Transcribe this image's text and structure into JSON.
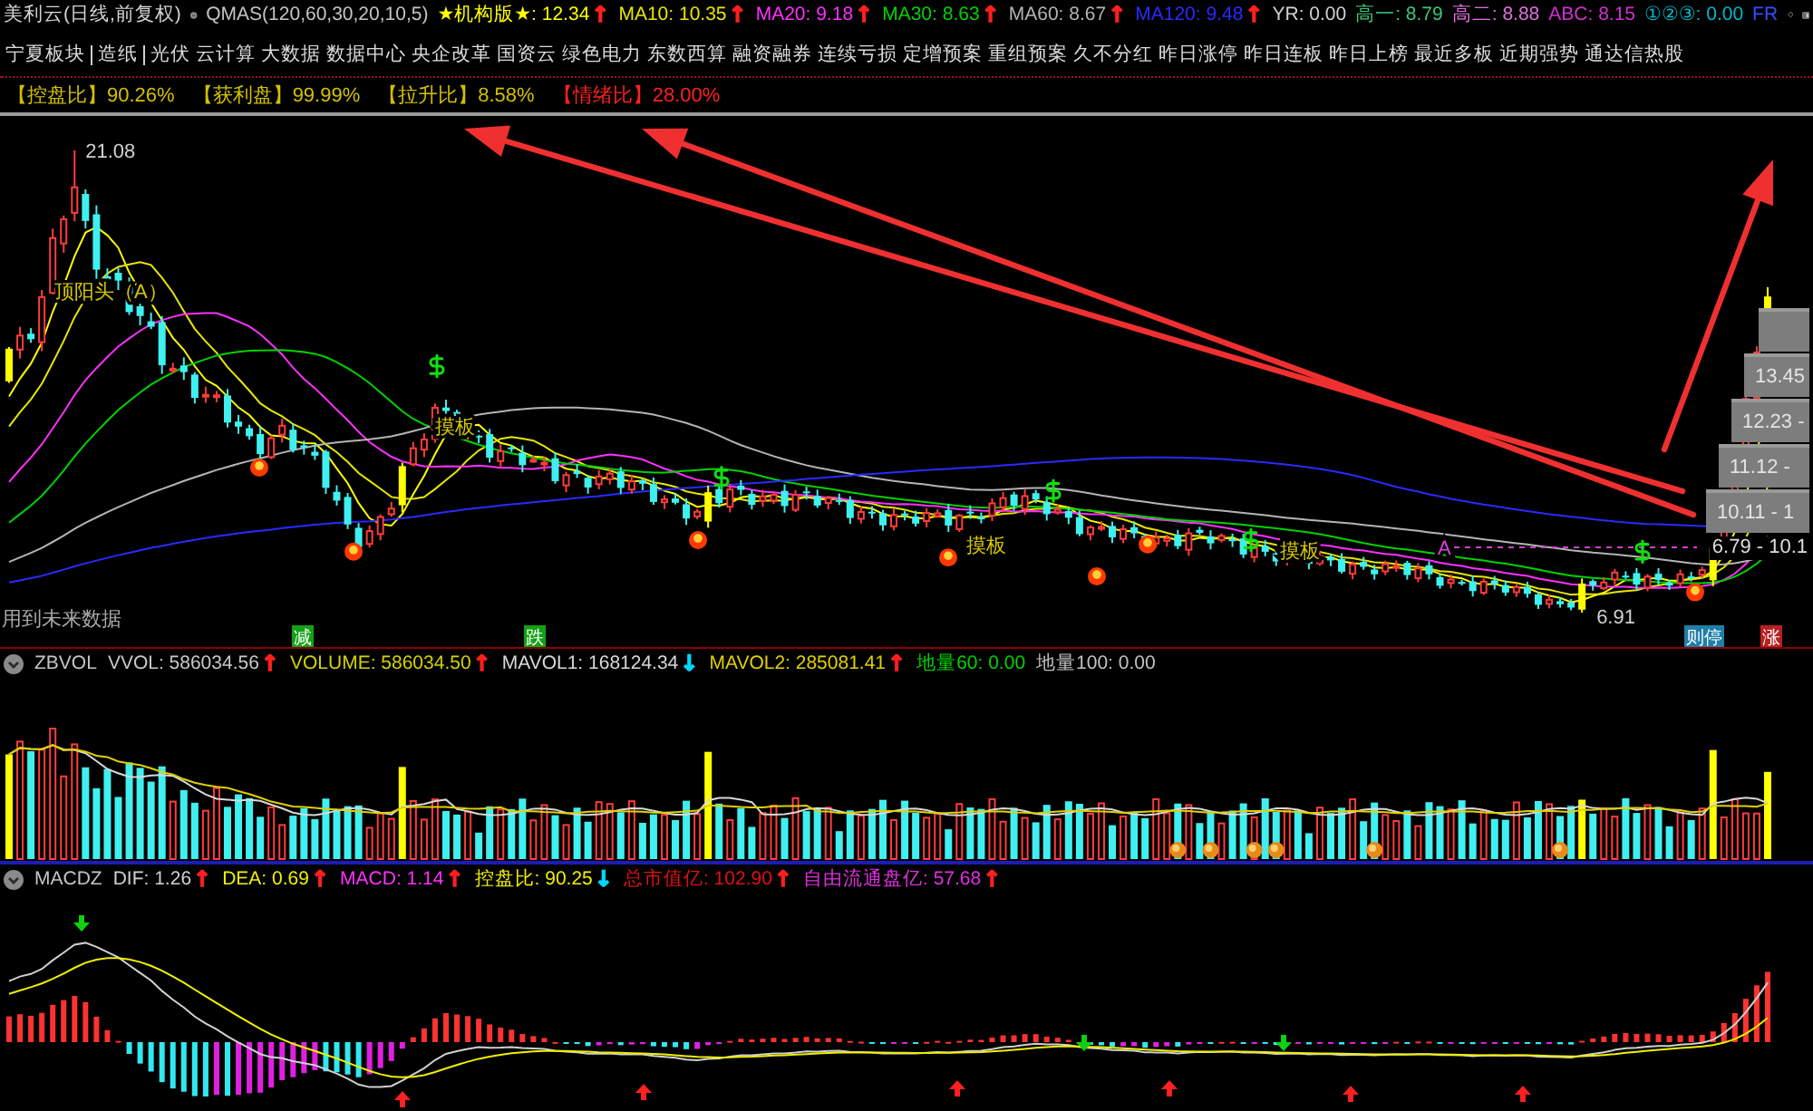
{
  "main_panel": {
    "title": "美利云(日线,前复权)",
    "indicator": "QMAS(120,60,30,20,10,5)",
    "readings": [
      {
        "text": "★机构版★: 12.34",
        "color": "#ffff00",
        "arrow": {
          "text": "↑",
          "color": "#ff2020"
        }
      },
      {
        "text": "MA10: 10.35",
        "color": "#e6e600",
        "arrow": {
          "text": "↑",
          "color": "#ff2020"
        }
      },
      {
        "text": "MA20: 9.18",
        "color": "#ff30ff",
        "arrow": {
          "text": "↑",
          "color": "#ff2020"
        }
      },
      {
        "text": "MA30: 8.63",
        "color": "#00d200",
        "arrow": {
          "text": "↑",
          "color": "#ff2020"
        }
      },
      {
        "text": "MA60: 8.67",
        "color": "#b4b4b4",
        "arrow": {
          "text": "↑",
          "color": "#ff2020"
        }
      },
      {
        "text": "MA120: 9.48",
        "color": "#2a2aff",
        "arrow": {
          "text": "↑",
          "color": "#ff2020"
        }
      },
      {
        "text": "YR: 0.00",
        "color": "#d0d0d0"
      },
      {
        "text": "高一: 8.79",
        "color": "#3cc878"
      },
      {
        "text": "高二: 8.88",
        "color": "#e070e0"
      },
      {
        "text": "ABC: 8.15",
        "color": "#d030d0"
      },
      {
        "text": "①②③: 0.00",
        "color": "#00b8c8"
      },
      {
        "text": "FR",
        "color": "#3050ff"
      }
    ],
    "region": "宁夏板块",
    "industry": "造纸",
    "concepts": [
      "光伏",
      "云计算",
      "大数据",
      "数据中心",
      "央企改革",
      "国资云",
      "绿色电力",
      "东数西算",
      "融资融券",
      "连续亏损",
      "定增预案",
      "重组预案",
      "久不分红",
      "昨日涨停",
      "昨日连板",
      "昨日上榜",
      "最近多板",
      "近期强势",
      "通达信热股"
    ],
    "stats": [
      {
        "text": "【控盘比】90.26%",
        "color": "#d2c000"
      },
      {
        "text": "【获利盘】99.99%",
        "color": "#d2c000"
      },
      {
        "text": "【拉升比】8.58%",
        "color": "#d2c000"
      },
      {
        "text": "【情绪比】28.00%",
        "color": "#ff2020"
      }
    ],
    "price_labels": {
      "high": "21.08",
      "low": "6.91"
    },
    "chart_labels": [
      "顶阳头（A）",
      "摸板",
      "摸板",
      "摸板"
    ],
    "point_label": "A",
    "price_ranges": [
      "13.45",
      "12.23 -",
      "11.12 -",
      "10.11 - 1"
    ],
    "range_note": "6.79 - 10.1",
    "footnote": "用到未来数据",
    "badges": [
      {
        "text": "减",
        "color": "#14a014"
      },
      {
        "text": "跌",
        "color": "#14a014"
      },
      {
        "text": "则停",
        "color": "#1f7fa8"
      },
      {
        "text": "涨",
        "color": "#b82020"
      }
    ]
  },
  "volume_panel": {
    "name": "ZBVOL",
    "readings": [
      {
        "text": "VVOL: 586034.56",
        "color": "#c8c8c8",
        "arrow": {
          "text": "↑",
          "color": "#ff2020"
        }
      },
      {
        "text": "VOLUME: 586034.50",
        "color": "#d2d200",
        "arrow": {
          "text": "↑",
          "color": "#ff2020"
        }
      },
      {
        "text": "MAVOL1: 168124.34",
        "color": "#d8d8d8",
        "arrow": {
          "text": "↓",
          "color": "#00d8ff"
        }
      },
      {
        "text": "MAVOL2: 285081.41",
        "color": "#e0d000",
        "arrow": {
          "text": "↑",
          "color": "#ff2020"
        }
      },
      {
        "text": "地量60: 0.00",
        "color": "#00d200"
      },
      {
        "text": "地量100: 0.00",
        "color": "#c0c0c0"
      }
    ]
  },
  "macd_panel": {
    "name": "MACDZ",
    "readings": [
      {
        "text": "DIF: 1.26",
        "color": "#d0d0d0",
        "arrow": {
          "text": "↑",
          "color": "#ff2020"
        }
      },
      {
        "text": "DEA: 0.69",
        "color": "#f0f000",
        "arrow": {
          "text": "↑",
          "color": "#ff2020"
        }
      },
      {
        "text": "MACD: 1.14",
        "color": "#ff30ff",
        "arrow": {
          "text": "↑",
          "color": "#ff2020"
        }
      },
      {
        "text": "控盘比: 90.25",
        "color": "#f0f000",
        "arrow": {
          "text": "↓",
          "color": "#00d8ff"
        }
      },
      {
        "text": "总市值亿: 102.90",
        "color": "#e01010",
        "arrow": {
          "text": "↑",
          "color": "#ff2020"
        }
      },
      {
        "text": "自由流通盘亿: 57.68",
        "color": "#e030e0",
        "arrow": {
          "text": "↑",
          "color": "#ff2020"
        }
      }
    ]
  }
}
